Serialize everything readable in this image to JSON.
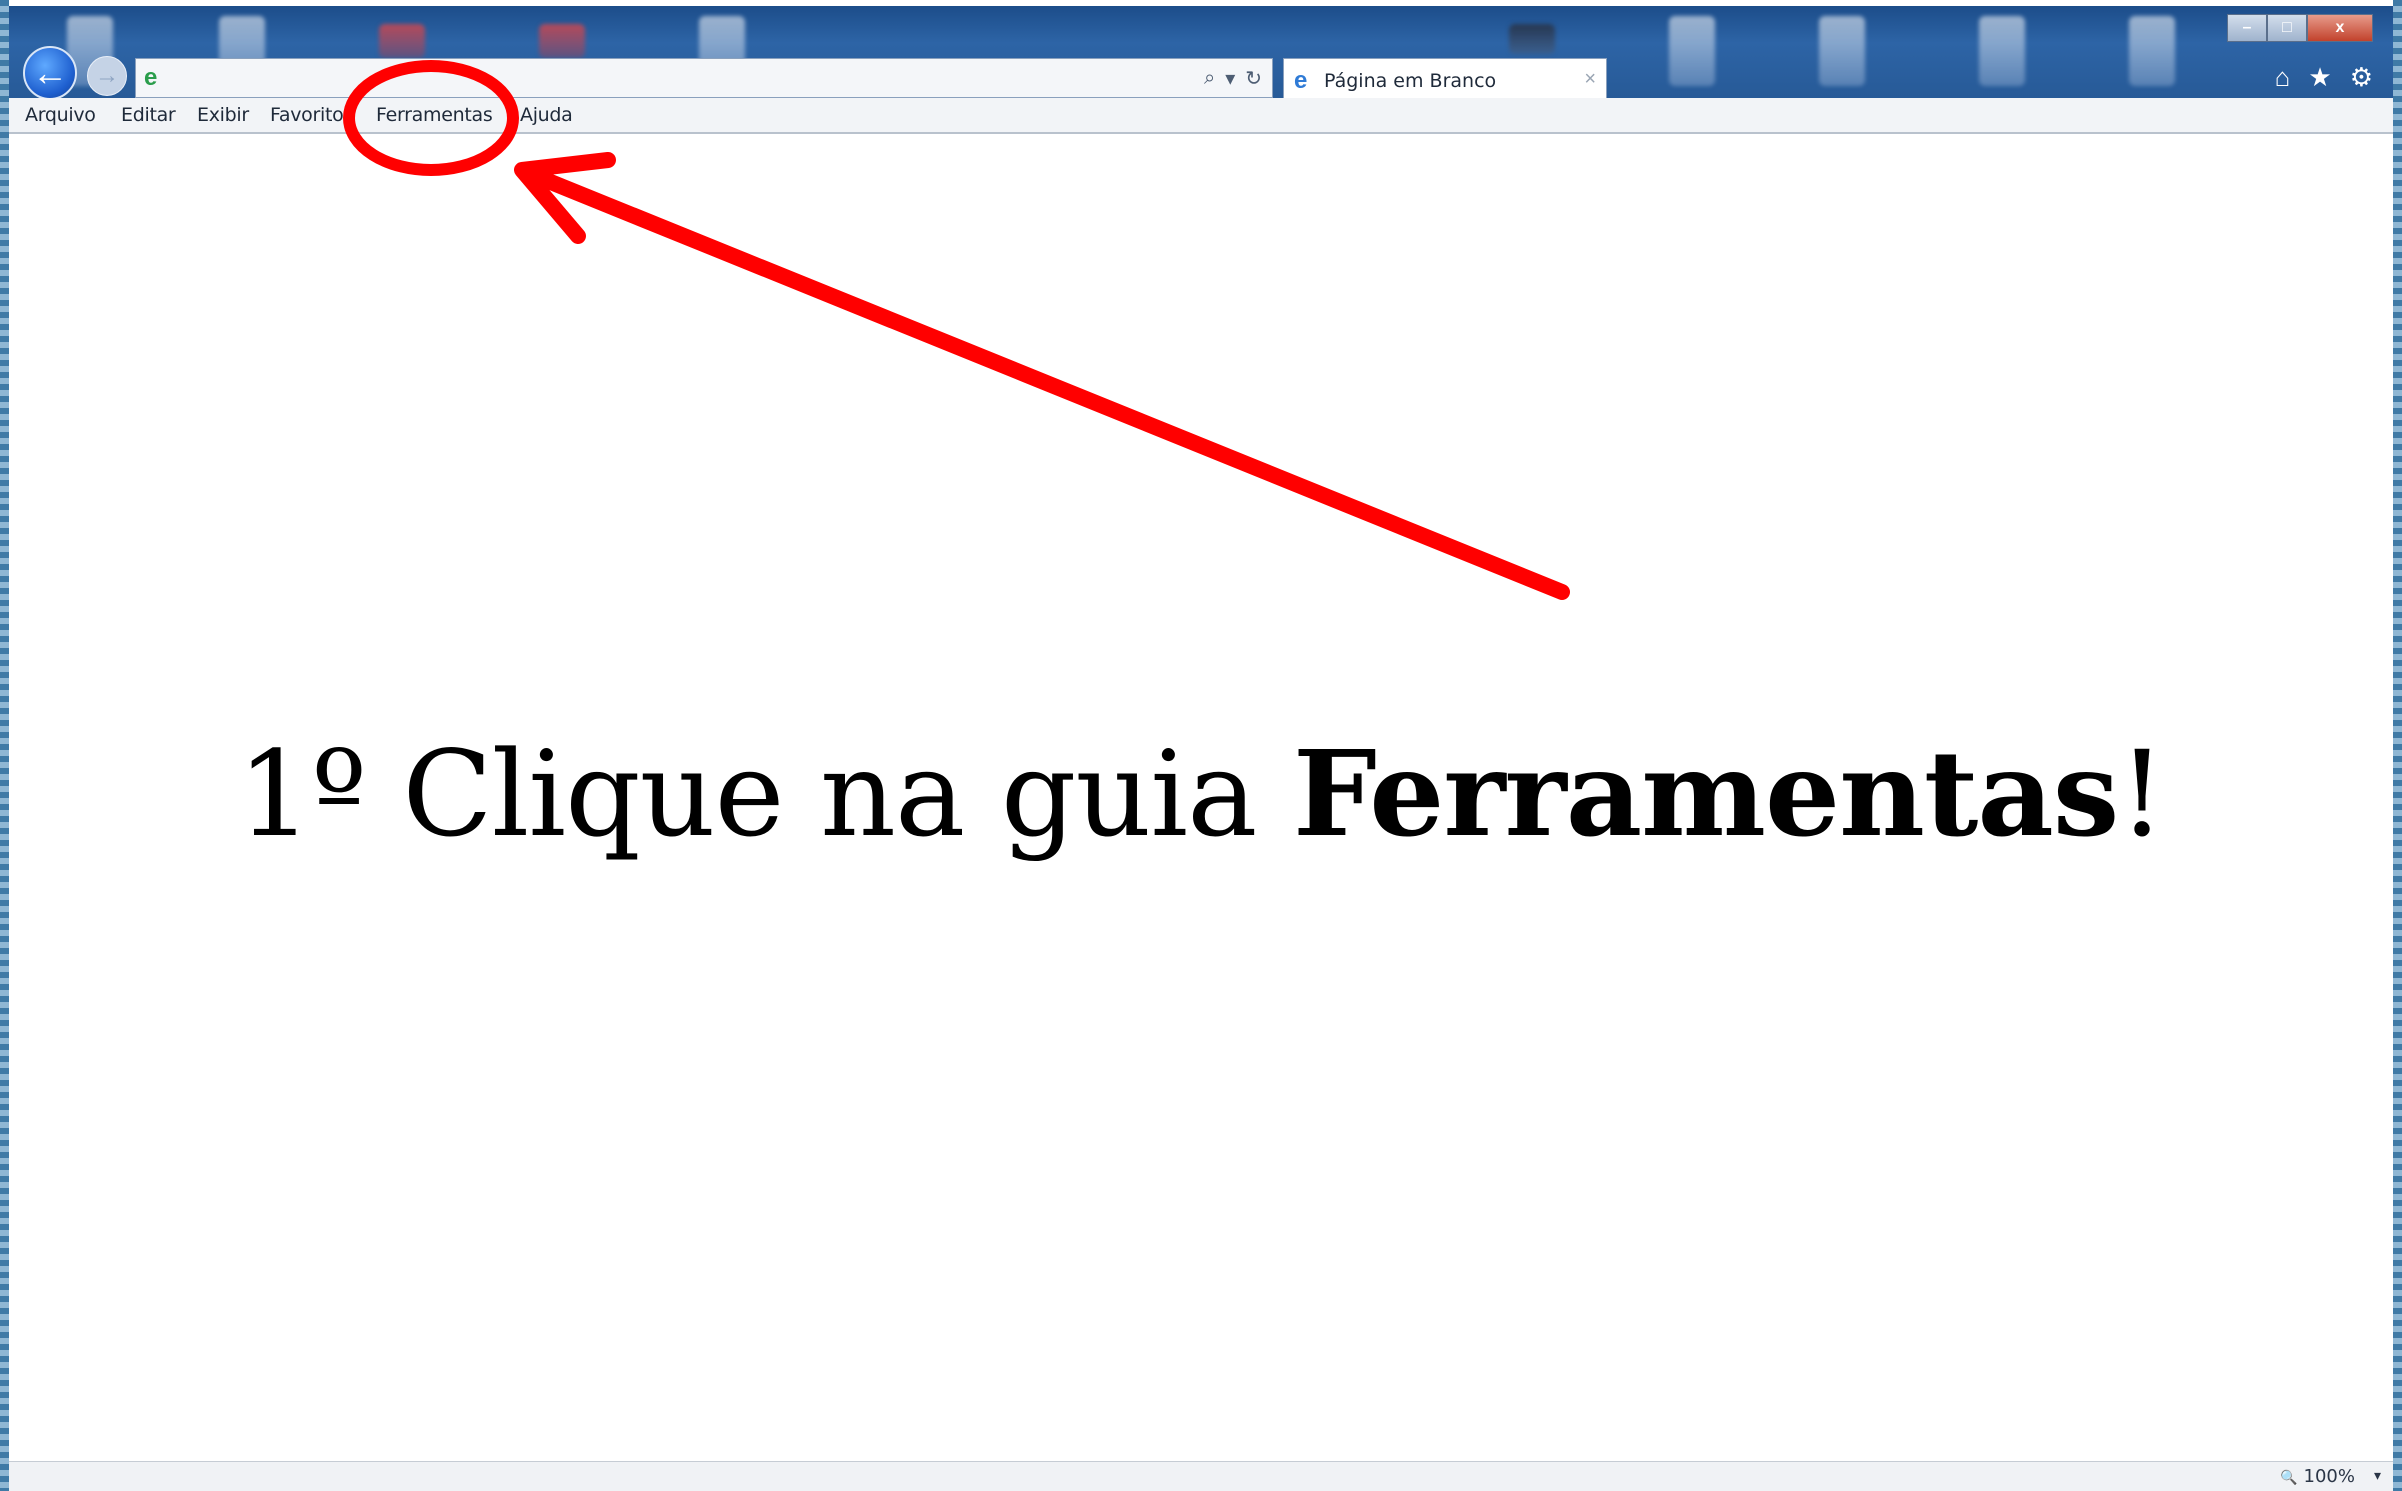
{
  "browser": {
    "tab_label": "Página em Branco",
    "tab_close": "×",
    "nav_back_glyph": "←",
    "nav_forward_glyph": "→",
    "address_icon": "e",
    "address_search_glyph": "⌕",
    "address_dropdown_glyph": "▾",
    "address_refresh_glyph": "↻",
    "window_minimize": "–",
    "window_maximize": "□",
    "window_close": "x",
    "home_icon": "⌂",
    "favorites_icon": "★",
    "tools_icon": "⚙"
  },
  "menubar": {
    "items": [
      "Arquivo",
      "Editar",
      "Exibir",
      "Favoritos",
      "Ferramentas",
      "Ajuda"
    ]
  },
  "content": {
    "instruction_prefix": "1º Clique na guia ",
    "instruction_bold": "Ferramentas",
    "instruction_suffix": "!"
  },
  "statusbar": {
    "zoom": "100%",
    "zoom_icon": "🔍",
    "zoom_dropdown": "▾"
  },
  "annotation": {
    "color": "#ff0000"
  }
}
